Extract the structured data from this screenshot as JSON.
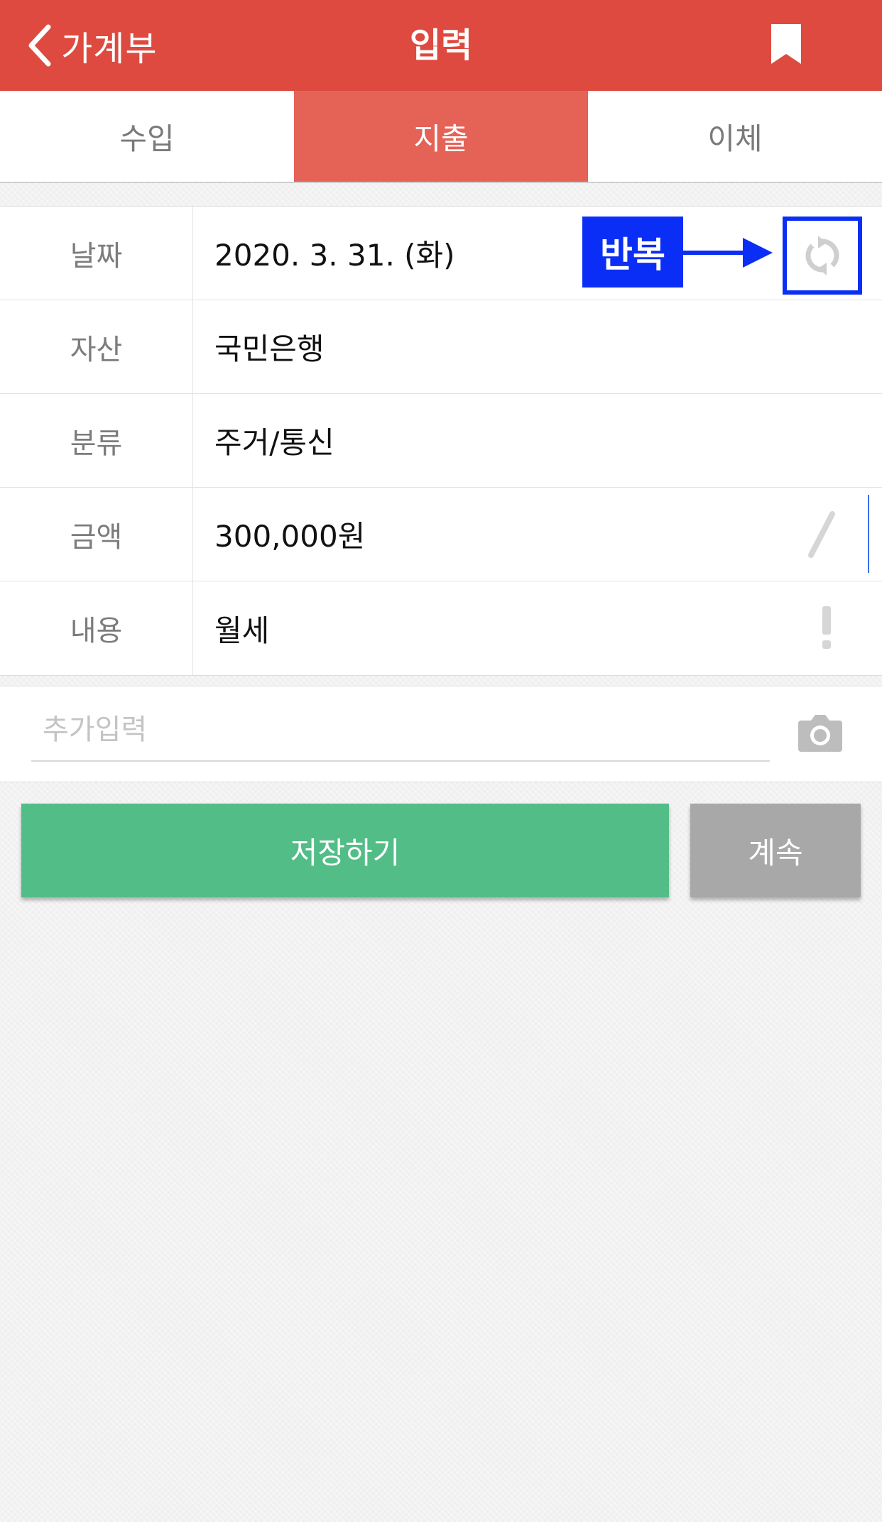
{
  "navbar": {
    "back_label": "가계부",
    "title": "입력",
    "background_color": "#de4a3f"
  },
  "tabs": [
    {
      "label": "수입",
      "active": false
    },
    {
      "label": "지출",
      "active": true
    },
    {
      "label": "이체",
      "active": false
    }
  ],
  "form": {
    "date": {
      "label": "날짜",
      "value": "2020. 3. 31. (화)"
    },
    "asset": {
      "label": "자산",
      "value": "국민은행"
    },
    "category": {
      "label": "분류",
      "value": "주거/통신"
    },
    "amount": {
      "label": "금액",
      "value": "300,000원"
    },
    "memo": {
      "label": "내용",
      "value": "월세"
    }
  },
  "repeat_annotation": {
    "label": "반복",
    "color": "#0a2ef5"
  },
  "extra": {
    "placeholder": "추가입력",
    "value": ""
  },
  "buttons": {
    "save_label": "저장하기",
    "continue_label": "계속",
    "save_color": "#53bd87",
    "continue_color": "#a8a8a8"
  },
  "icons": {
    "back": "chevron-left-icon",
    "bookmark": "bookmark-icon",
    "repeat": "repeat-icon",
    "calculator": "slash-icon",
    "memo_alert": "exclamation-icon",
    "camera": "camera-icon"
  }
}
